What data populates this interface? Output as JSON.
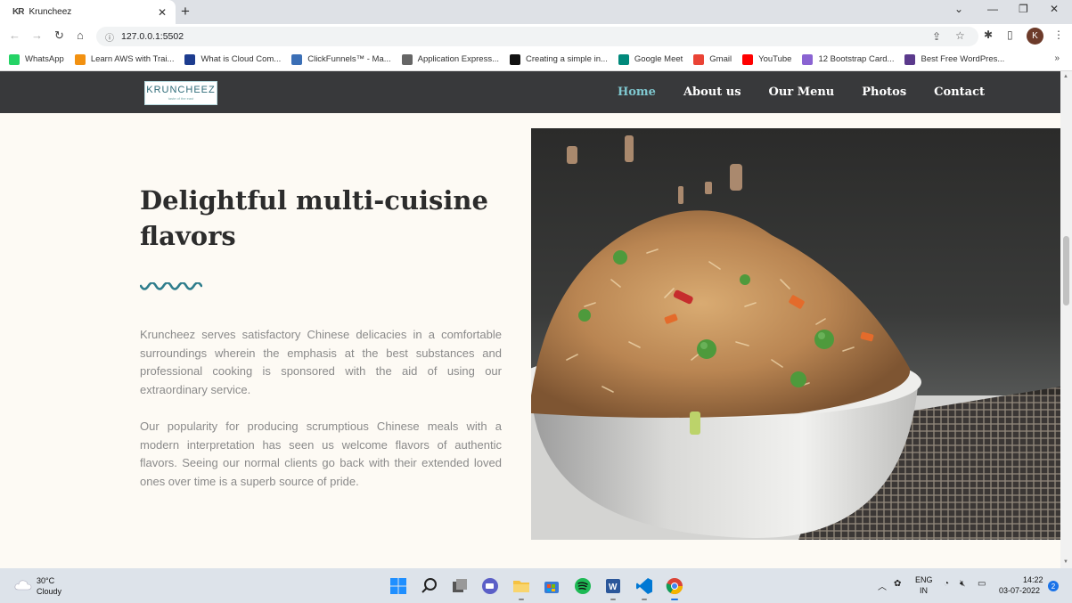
{
  "browser": {
    "tab_favicon": "KR",
    "tab_title": "Kruncheez",
    "tab_close": "✕",
    "new_tab": "+",
    "url": "127.0.0.1:5502",
    "profile_initial": "K",
    "bookmarks": [
      {
        "label": "WhatsApp",
        "color": "#25d366"
      },
      {
        "label": "Learn AWS with Trai...",
        "color": "#f29111"
      },
      {
        "label": "What is Cloud Com...",
        "color": "#1d3c8f"
      },
      {
        "label": "ClickFunnels™ - Ma...",
        "color": "#3b6fb6"
      },
      {
        "label": "Application Express...",
        "color": "#666666"
      },
      {
        "label": "Creating a simple in...",
        "color": "#111111"
      },
      {
        "label": "Google Meet",
        "color": "#00897b"
      },
      {
        "label": "Gmail",
        "color": "#ea4335"
      },
      {
        "label": "YouTube",
        "color": "#ff0000"
      },
      {
        "label": "12 Bootstrap Card...",
        "color": "#8a63d2"
      },
      {
        "label": "Best Free WordPres...",
        "color": "#5b3a8c"
      }
    ],
    "bookmarks_more": "»"
  },
  "site": {
    "logo_text": "KRUNCHEEZ",
    "logo_tagline": "taste of the east",
    "nav": [
      {
        "label": "Home",
        "active": true
      },
      {
        "label": "About us",
        "active": false
      },
      {
        "label": "Our Menu",
        "active": false
      },
      {
        "label": "Photos",
        "active": false
      },
      {
        "label": "Contact",
        "active": false
      }
    ],
    "hero_title": "Delightful multi-cuisine flavors",
    "paragraphs": [
      "Kruncheez serves satisfactory Chinese delicacies in a comfortable surroundings wherein the emphasis at the best substances and professional cooking is sponsored with the aid of using our extraordinary service.",
      "Our popularity for producing scrumptious Chinese meals with a modern interpretation has seen us welcome flavors of authentic flavors. Seeing our normal clients go back with their extended loved ones over time is a superb source of pride."
    ],
    "accent_color": "#2e7d8c"
  },
  "taskbar": {
    "temperature": "30°C",
    "condition": "Cloudy",
    "language_1": "ENG",
    "language_2": "IN",
    "time": "14:22",
    "date": "03-07-2022",
    "notifications": "2"
  }
}
